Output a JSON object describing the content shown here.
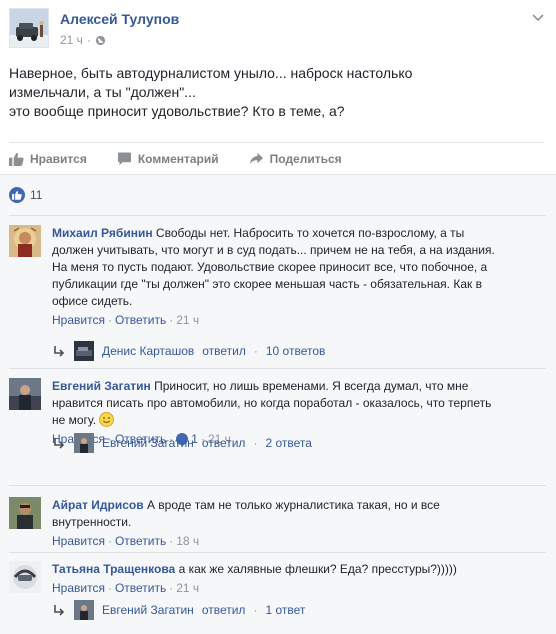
{
  "post": {
    "author": "Алексей Тулупов",
    "time": "21 ч",
    "text_lines": [
      "Наверное, быть автодурналистом уныло... наброск настолько",
      "измельчали, а ты \"должен\"...",
      "это вообще приносит удовольствие? Кто в теме, а?"
    ],
    "actions": {
      "like": "Нравится",
      "comment": "Комментарий",
      "share": "Поделиться"
    },
    "likes_count": "11"
  },
  "comments": [
    {
      "author": "Михаил Рябинин",
      "text": "Свободы нет. Набросить то хочется по-взрослому, а ты должен учитывать, что могут и в суд подать... причем не на тебя, а на издания. На меня то пусть подают. Удовольствие скорее приносит все, что побочное, а публикации где \"ты должен\" это скорее меньшая часть - обязательная. Как в офисе сидеть.",
      "like": "Нравится",
      "reply": "Ответить",
      "time": "21 ч",
      "replies": {
        "author": "Денис Карташов",
        "verb": "ответил",
        "count": "10 ответов"
      }
    },
    {
      "author": "Евгений Загатин",
      "text": "Приносит, но лишь временами. Я всегда думал, что мне нравится писать про автомобили, но когда поработал - оказалось, что терпеть не могу.",
      "like": "Нравится",
      "reply": "Ответить",
      "likes": "1",
      "time": "21 ч",
      "replies": {
        "author": "Евгений Загатин",
        "verb": "ответил",
        "count": "2 ответа"
      }
    },
    {
      "author": "Айрат Идрисов",
      "text": "А вроде там не только журналистика такая, но и все внутренности.",
      "like": "Нравится",
      "reply": "Ответить",
      "time": "18 ч"
    },
    {
      "author": "Татьяна Тращенкова",
      "text": "а как же халявные флешки? Еда? пресстуры?)))))",
      "like": "Нравится",
      "reply": "Ответить",
      "time": "21 ч",
      "replies": {
        "author": "Евгений Загатин",
        "verb": "ответил",
        "count": "1 ответ"
      }
    }
  ],
  "colors": {
    "link": "#365899",
    "muted": "#90949c",
    "like_blue": "#4267b2",
    "comments_bg": "#f6f7f9"
  }
}
